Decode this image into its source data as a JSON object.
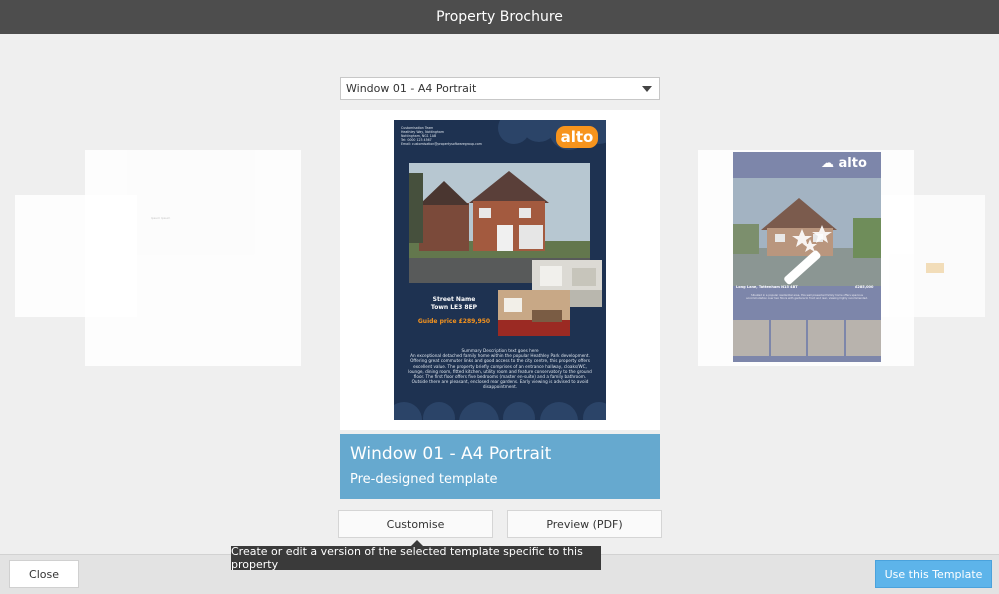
{
  "window": {
    "title": "Property Brochure"
  },
  "template_select": {
    "value": "Window 01 - A4 Portrait"
  },
  "selected_template": {
    "name": "Window 01 - A4 Portrait",
    "subtitle": "Pre-designed template"
  },
  "buttons": {
    "customise": "Customise",
    "preview": "Preview (PDF)",
    "close": "Close",
    "use": "Use this Template"
  },
  "tooltip": {
    "text": "Create or edit a version of the selected template specific to this property"
  },
  "brochure": {
    "logo": "alto",
    "street": "Street Name",
    "town": "Town LE3 8EP",
    "guide": "Guide price £289,950",
    "summary_title": "Summary Description text goes here",
    "summary": "An exceptional detached family home within the popular Heathley Park development. Offering great commuter links and good access to the city centre, this property offers excellent value. The property briefly comprises of an entrance hallway, cloaks/WC, lounge, dining room, fitted kitchen, utility room and feature conservatory to the ground floor. The first floor offers five bedrooms (master en-suite) and a family bathroom. Outside there are pleasant, enclosed rear gardens. Early viewing is advised to avoid disappointment.",
    "contact": "Customisation Team\nHeathley Way, Nottingham\nNottingham, NG1 1AB\nTel: 0000 123 4567\nEmail: customisation@propertysoftwaregroup.com"
  },
  "brochure_right": {
    "logo": "alto",
    "location": "Long Lane, Tottenham N15 4BT",
    "price": "£285,000",
    "text": "Situated in a popular residential area, this well presented family home offers spacious accommodation over two floors with gardens to front and rear, viewing highly recommended."
  },
  "ghost_left_text": "Ipsum Ipsum",
  "colors": {
    "accent": "#66a9cf",
    "primary_button": "#5db4ea",
    "titlebar": "#4d4d4d",
    "brochure_bg": "#1e3251",
    "logo_orange": "#f7941d"
  }
}
